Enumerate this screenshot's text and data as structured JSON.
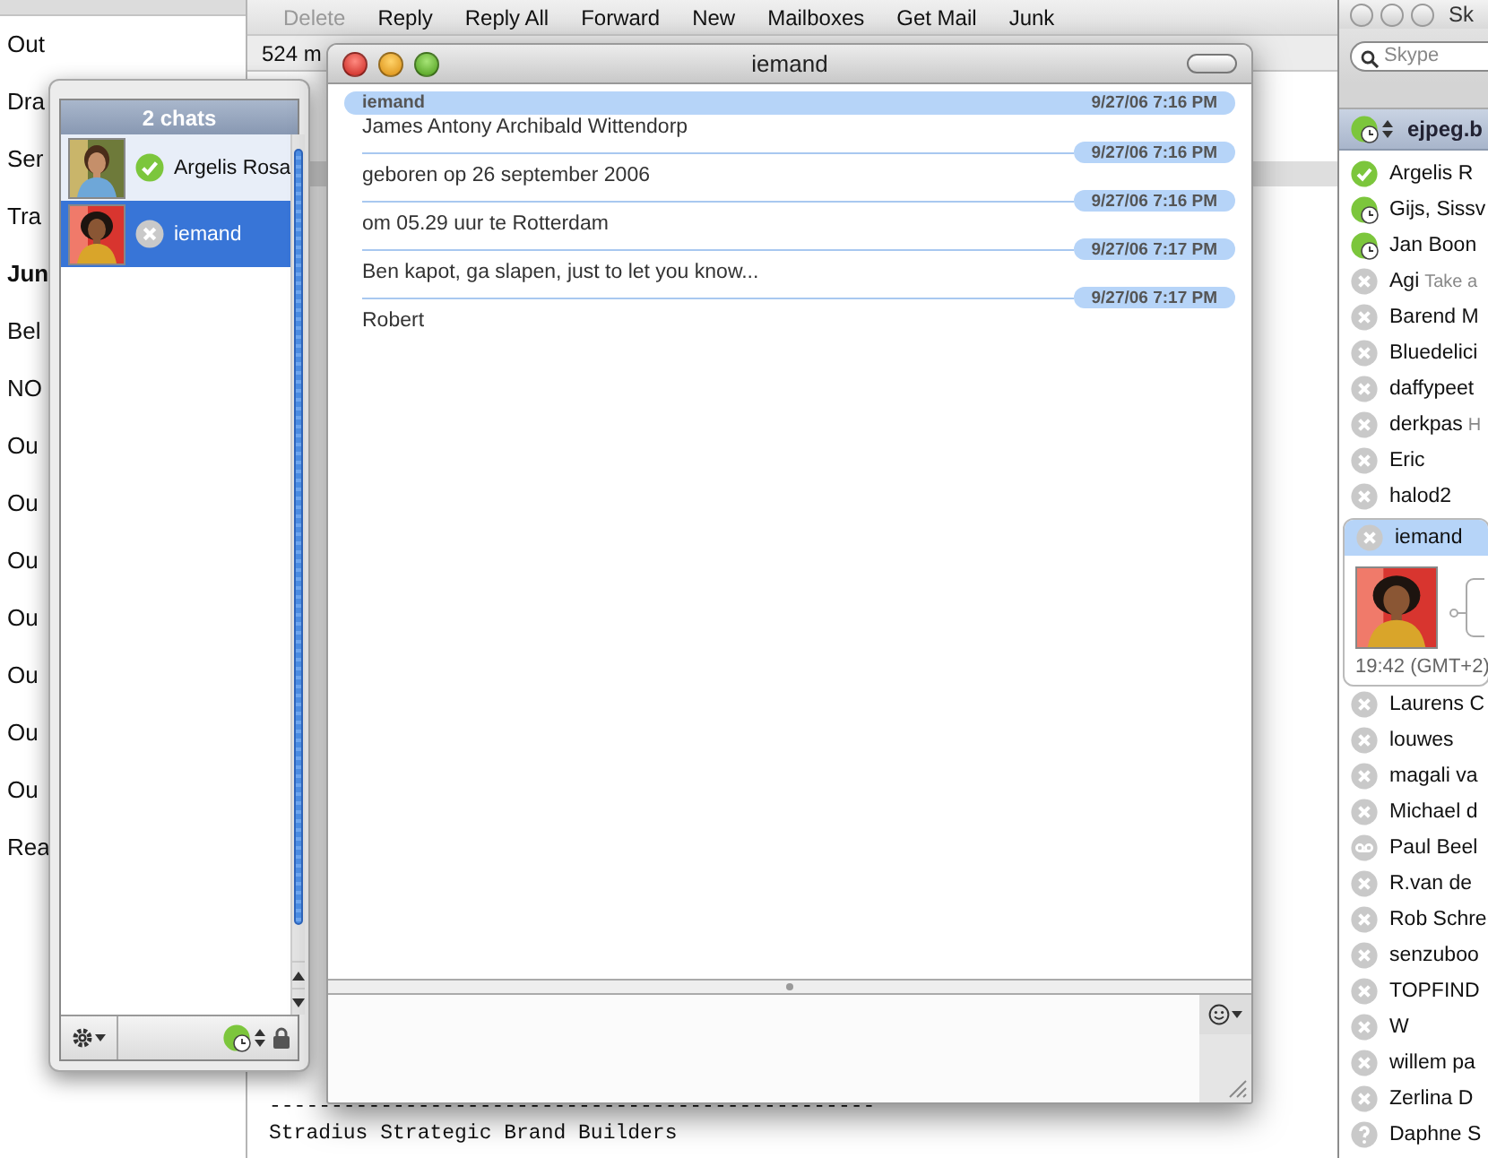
{
  "mail": {
    "mailboxes": [
      {
        "label": "Out",
        "unread": false
      },
      {
        "label": "Dra",
        "unread": false
      },
      {
        "label": "Ser",
        "unread": false
      },
      {
        "label": "Tra",
        "unread": false
      },
      {
        "label": "Jun",
        "unread": true
      },
      {
        "label": "Bel",
        "unread": false
      },
      {
        "label": "NO",
        "unread": false
      },
      {
        "label": "Ou",
        "unread": false
      },
      {
        "label": "Ou",
        "unread": false
      },
      {
        "label": "Ou",
        "unread": false
      },
      {
        "label": "Ou",
        "unread": false
      },
      {
        "label": "Ou",
        "unread": false
      },
      {
        "label": "Ou",
        "unread": false
      },
      {
        "label": "Ou",
        "unread": false
      },
      {
        "label": "Rea",
        "unread": false
      }
    ],
    "toolbar": [
      {
        "label": "Delete",
        "disabled": true
      },
      {
        "label": "Reply",
        "disabled": false
      },
      {
        "label": "Reply All",
        "disabled": false
      },
      {
        "label": "Forward",
        "disabled": false
      },
      {
        "label": "New",
        "disabled": false
      },
      {
        "label": "Mailboxes",
        "disabled": false
      },
      {
        "label": "Get Mail",
        "disabled": false
      },
      {
        "label": "Junk",
        "disabled": false
      }
    ],
    "message_count": "524 m",
    "body_lines": [
      "-------------------------------------------------",
      "Stradius Strategic Brand Builders"
    ]
  },
  "chats": {
    "title": "2 chats",
    "items": [
      {
        "name": "Argelis Rosa",
        "kind": "online",
        "selected": false
      },
      {
        "name": "iemand",
        "kind": "offline",
        "selected": true
      }
    ]
  },
  "chat": {
    "title": "iemand",
    "messages": [
      {
        "sender": "iemand",
        "time": "9/27/06 7:16 PM",
        "text": "James Antony Archibald Wittendorp"
      },
      {
        "time": "9/27/06 7:16 PM",
        "text": "geboren op 26 september 2006"
      },
      {
        "time": "9/27/06 7:16 PM",
        "text": "om 05.29 uur te Rotterdam"
      },
      {
        "time": "9/27/06 7:17 PM",
        "text": "Ben kapot, ga slapen, just to let you know..."
      },
      {
        "time": "9/27/06 7:17 PM",
        "text": "Robert"
      }
    ]
  },
  "skype": {
    "title": "Sk",
    "search": {
      "placeholder": "Skype"
    },
    "account": "ejpeg.b",
    "contacts": [
      {
        "name": "Argelis R",
        "kind": "online",
        "selected": false
      },
      {
        "name": "Gijs, Sissv",
        "kind": "away",
        "selected": false
      },
      {
        "name": "Jan Boon",
        "kind": "away",
        "selected": false
      },
      {
        "name": "Agi",
        "mood": "Take a",
        "kind": "offline",
        "selected": false
      },
      {
        "name": "Barend M",
        "kind": "offline",
        "selected": false
      },
      {
        "name": "Bluedelici",
        "kind": "offline",
        "selected": false
      },
      {
        "name": "daffypeet",
        "kind": "offline",
        "selected": false
      },
      {
        "name": "derkpas",
        "mood": "H",
        "kind": "offline",
        "selected": false
      },
      {
        "name": "Eric",
        "kind": "offline",
        "selected": false
      },
      {
        "name": "halod2",
        "kind": "offline",
        "selected": false
      },
      {
        "name": "iemand",
        "kind": "offline",
        "selected": true,
        "local_time": "19:42 (GMT+2)"
      },
      {
        "name": "Laurens C",
        "kind": "offline",
        "selected": false
      },
      {
        "name": "louwes",
        "kind": "offline",
        "selected": false
      },
      {
        "name": "magali va",
        "kind": "offline",
        "selected": false
      },
      {
        "name": "Michael d",
        "kind": "offline",
        "selected": false
      },
      {
        "name": "Paul Beel",
        "kind": "voicemail",
        "selected": false
      },
      {
        "name": "R.van de",
        "kind": "offline",
        "selected": false
      },
      {
        "name": "Rob Schre",
        "kind": "offline",
        "selected": false
      },
      {
        "name": "senzuboo",
        "kind": "offline",
        "selected": false
      },
      {
        "name": "TOPFIND",
        "kind": "offline",
        "selected": false
      },
      {
        "name": "W",
        "kind": "offline",
        "selected": false
      },
      {
        "name": "willem pa",
        "kind": "offline",
        "selected": false
      },
      {
        "name": "Zerlina D",
        "kind": "offline",
        "selected": false
      },
      {
        "name": "Daphne S",
        "kind": "unknown",
        "selected": false
      }
    ]
  }
}
